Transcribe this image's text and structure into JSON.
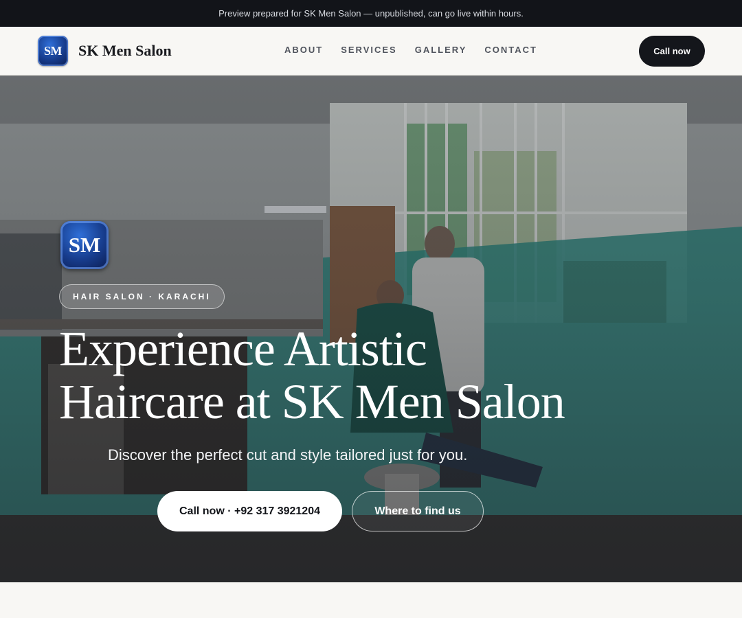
{
  "announcement": "Preview prepared for SK Men Salon — unpublished, can go live within hours.",
  "brand": {
    "monogram": "SM",
    "name": "SK Men Salon"
  },
  "nav": {
    "links": [
      "ABOUT",
      "SERVICES",
      "GALLERY",
      "CONTACT"
    ],
    "cta": "Call now"
  },
  "hero": {
    "monogram": "SM",
    "tag": "HAIR SALON · KARACHI",
    "title_line1": "Experience Artistic",
    "title_line2": "Haircare at SK Men Salon",
    "subtitle": "Discover the perfect cut and style tailored just for you.",
    "primary_button": "Call now · +92 317 3921204",
    "secondary_button": "Where to find us"
  },
  "colors": {
    "topbar_bg": "#121419",
    "page_bg": "#f8f7f4",
    "brand_blue": "#173c8c",
    "cta_dark": "#14161b",
    "wall_teal": "#2f8f86"
  }
}
